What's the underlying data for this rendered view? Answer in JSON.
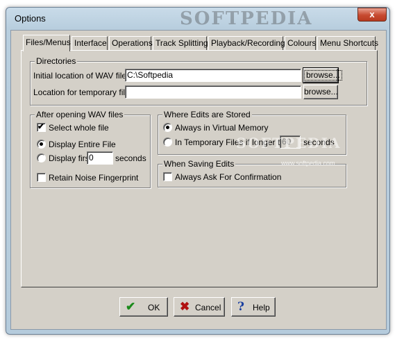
{
  "window": {
    "title": "Options",
    "close_glyph": "x"
  },
  "watermark": {
    "top": "SOFTPEDIA",
    "middle": "SOFTPEDIA",
    "small": "www.softpedia.com"
  },
  "tabs": [
    {
      "label": "Files/Menus"
    },
    {
      "label": "Interface"
    },
    {
      "label": "Operations"
    },
    {
      "label": "Track Splitting"
    },
    {
      "label": "Playback/Recording"
    },
    {
      "label": "Colours"
    },
    {
      "label": "Menu Shortcuts"
    }
  ],
  "directories": {
    "title": "Directories",
    "wav_label": "Initial location of WAV files:",
    "wav_value": "C:\\Softpedia",
    "temp_label": "Location for temporary files:",
    "temp_value": "",
    "browse_label": "browse..."
  },
  "after_opening": {
    "title": "After opening WAV files",
    "select_whole": "Select whole file",
    "display_entire": "Display Entire File",
    "display_first": "Display first",
    "display_first_value": "0",
    "seconds": "seconds",
    "retain": "Retain Noise Fingerprint"
  },
  "edits_stored": {
    "title": "Where Edits are Stored",
    "virtual": "Always in Virtual Memory",
    "temp_files": "In Temporary Files if longer than",
    "temp_value": "60",
    "seconds": "seconds"
  },
  "when_saving": {
    "title": "When Saving Edits",
    "ask": "Always Ask For Confirmation"
  },
  "buttons": {
    "ok": "OK",
    "cancel": "Cancel",
    "help": "Help"
  },
  "colors": {
    "ok_icon": "#1a8a1a",
    "cancel_icon": "#b01010",
    "help_icon": "#1a3fa0"
  }
}
